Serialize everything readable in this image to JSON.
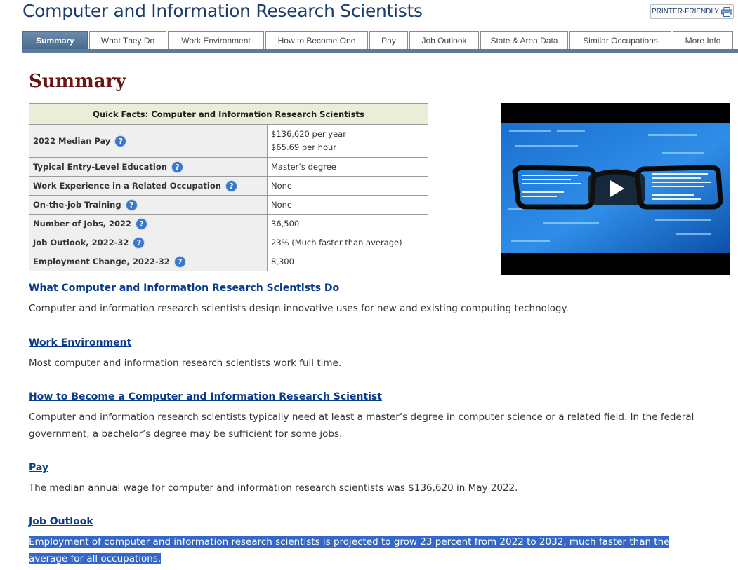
{
  "header": {
    "title": "Computer and Information Research Scientists",
    "printer_label": "PRINTER-FRIENDLY"
  },
  "tabs": [
    {
      "label": "Summary",
      "active": true
    },
    {
      "label": "What They Do"
    },
    {
      "label": "Work Environment"
    },
    {
      "label": "How to Become One"
    },
    {
      "label": "Pay"
    },
    {
      "label": "Job Outlook"
    },
    {
      "label": "State & Area Data"
    },
    {
      "label": "Similar Occupations"
    },
    {
      "label": "More Info"
    }
  ],
  "summary_heading": "Summary",
  "quick_facts": {
    "caption": "Quick Facts: Computer and Information Research Scientists",
    "rows": [
      {
        "label": "2022 Median Pay",
        "values": [
          "$136,620 per year",
          "$65.69 per hour"
        ]
      },
      {
        "label": "Typical Entry-Level Education",
        "values": [
          "Master’s degree"
        ]
      },
      {
        "label": "Work Experience in a Related Occupation",
        "values": [
          "None"
        ]
      },
      {
        "label": "On-the-job Training",
        "values": [
          "None"
        ]
      },
      {
        "label": "Number of Jobs, 2022",
        "values": [
          "36,500"
        ]
      },
      {
        "label": "Job Outlook, 2022-32",
        "values": [
          "23% (Much faster than average)"
        ]
      },
      {
        "label": "Employment Change, 2022-32",
        "values": [
          "8,300"
        ]
      }
    ],
    "help_icon_glyph": "?"
  },
  "video": {
    "icon": "play-icon"
  },
  "sections": [
    {
      "link": "What Computer and Information Research Scientists Do",
      "text": "Computer and information research scientists design innovative uses for new and existing computing technology."
    },
    {
      "link": "Work Environment",
      "text": "Most computer and information research scientists work full time."
    },
    {
      "link": "How to Become a Computer and Information Research Scientist",
      "text": "Computer and information research scientists typically need at least a master’s degree in computer science or a related field. In the federal government, a bachelor’s degree may be sufficient for some jobs."
    },
    {
      "link": "Pay",
      "text": "The median annual wage for computer and information research scientists was $136,620 in May 2022."
    },
    {
      "link": "Job Outlook",
      "text": "Employment of computer and information research scientists is projected to grow 23 percent from 2022 to 2032, much faster than the average for all occupations.",
      "highlighted": true
    }
  ],
  "colors": {
    "title": "#1a3d6b",
    "heading": "#6b1414",
    "link": "#0a3c8c",
    "tab_active": "#4a6b8d",
    "selection": "#3368c9"
  }
}
